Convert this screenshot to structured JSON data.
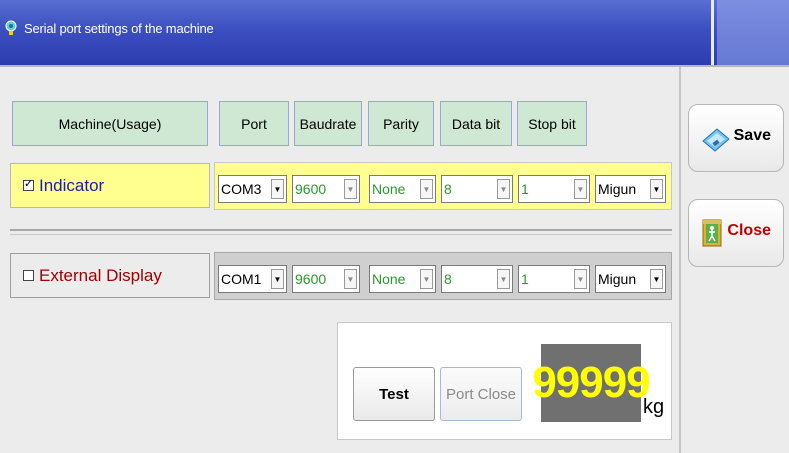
{
  "window": {
    "title": "Serial port settings of the machine",
    "accent": "#3c4fc0"
  },
  "headers": {
    "machine": "Machine(Usage)",
    "port": "Port",
    "baudrate": "Baudrate",
    "parity": "Parity",
    "databit": "Data bit",
    "stopbit": "Stop bit"
  },
  "rows": [
    {
      "label": "Indicator",
      "checked": true,
      "port": "COM3",
      "baudrate": "9600",
      "parity": "None",
      "databit": "8",
      "stopbit": "1",
      "protocol": "Migun",
      "highlight": "#ffff8f"
    },
    {
      "label": "External Display",
      "checked": false,
      "port": "COM1",
      "baudrate": "9600",
      "parity": "None",
      "databit": "8",
      "stopbit": "1",
      "protocol": "Migun"
    }
  ],
  "buttons": {
    "save": "Save",
    "close": "Close",
    "test": "Test",
    "port_close": "Port Close"
  },
  "display": {
    "weight": "99999",
    "unit": "kg",
    "digit_color": "#ffff00"
  },
  "icons": {
    "title": "app-icon",
    "save": "disk-save-icon",
    "close": "exit-door-icon"
  }
}
